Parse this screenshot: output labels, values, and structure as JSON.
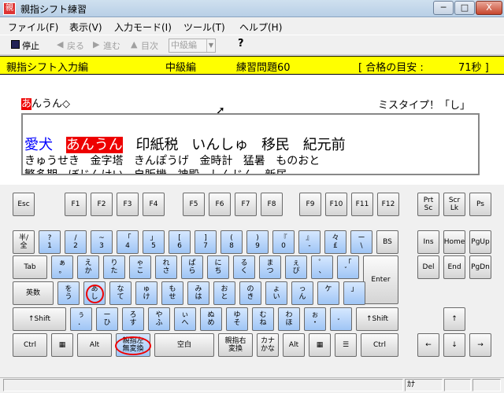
{
  "window": {
    "title": "親指シフト練習",
    "minimize": "─",
    "maximize": "□",
    "close": "X"
  },
  "menu": [
    "ファイル(F)",
    "表示(V)",
    "入力モード(I)",
    "ツール(T)",
    "ヘルプ(H)"
  ],
  "toolbar": {
    "stop": "停止",
    "back": "戻る",
    "forward": "進む",
    "target": "目次",
    "level": "中級編",
    "help": "?"
  },
  "infobar": {
    "mode": "親指シフト入力編",
    "level": "中級編",
    "problem": "練習問題60",
    "pass_label": "[ 合格の目安 :",
    "pass_value": "71秒 ]"
  },
  "practice": {
    "current_hi": "あ",
    "current_rest": "んうん◇",
    "miss": "ミスタイプ！「し」",
    "words": [
      "愛犬",
      "あんうん",
      "印紙税",
      "いんしゅ",
      "移民",
      "紀元前"
    ],
    "yomi": [
      "きゅうせき",
      "金字塔",
      "きんぽうげ",
      "金時計",
      "猛暑",
      "ものおと"
    ],
    "next": [
      "繁多期",
      "ぼじんけい",
      "自販機",
      "神殿",
      "しんじん",
      "新居"
    ]
  },
  "status": {
    "kana": "ｶﾅ"
  },
  "colors": {
    "accent": "#ffff00",
    "highlight": "#e00000",
    "key_blue": "#9fc5f5"
  }
}
